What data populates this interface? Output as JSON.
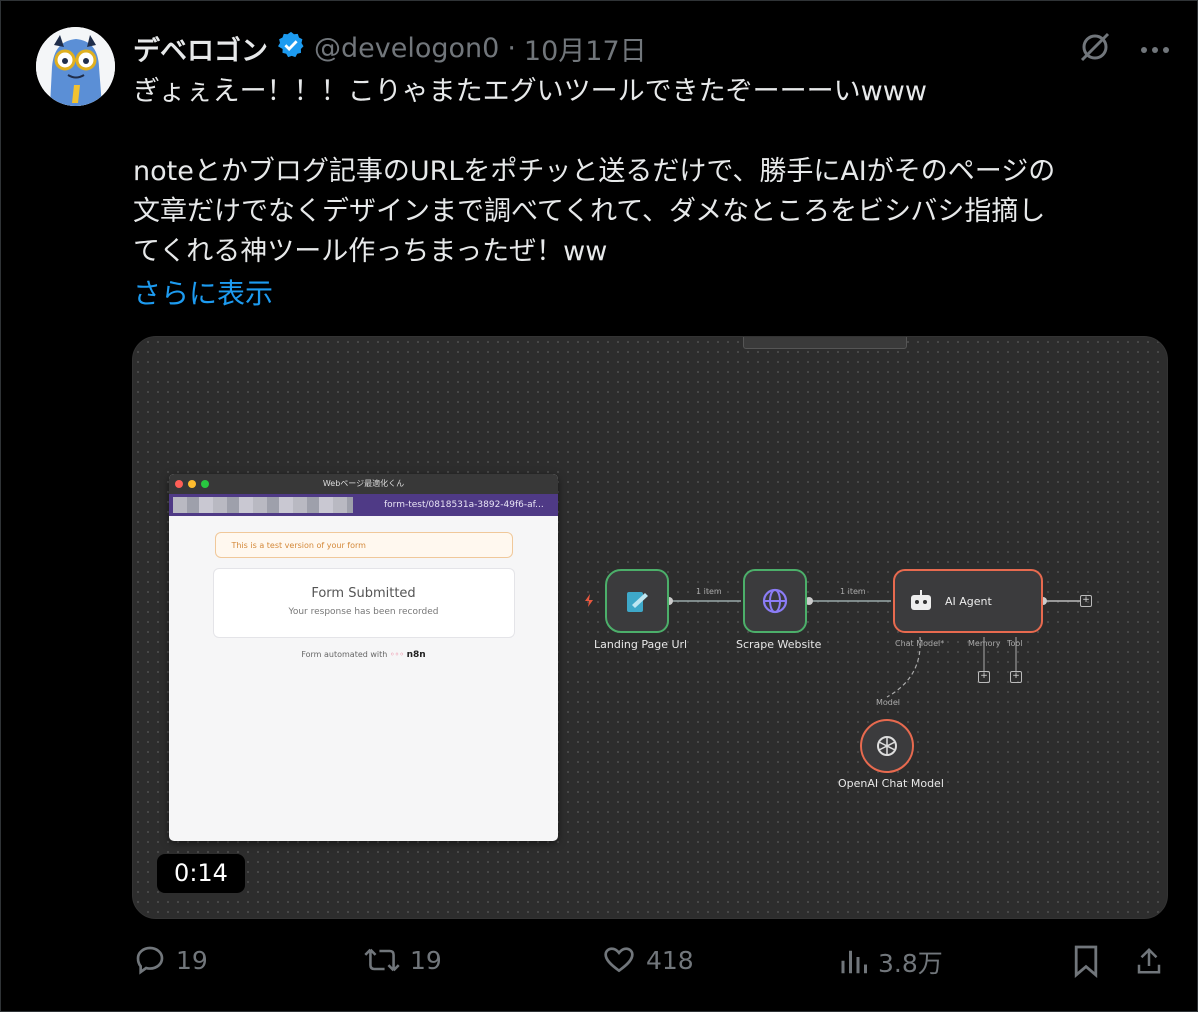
{
  "tweet": {
    "author_name": "デベロゴン",
    "handle": "@develogon0",
    "separator": "·",
    "date": "10月17日",
    "verified_color": "#1d9bf0",
    "text_line1": "ぎょぇえー！！！こりゃまたエグいツールできたぞーーーいwww",
    "text_line2": "noteとかブログ記事のURLをポチッと送るだけで、勝手にAIがそのページの",
    "text_line3": "文章だけでなくデザインまで調べてくれて、ダメなところをビシバシ指摘し",
    "text_line4": "てくれる神ツール作っちまったぜ！ww",
    "show_more": "さらに表示"
  },
  "media": {
    "window_title": "Webページ最適化くん",
    "url_text": "form-test/0818531a-3892-49f6-af...",
    "test_notice": "This is a test version of your form",
    "card_title": "Form Submitted",
    "card_subtitle": "Your response has been recorded",
    "powered_by": "Form automated with",
    "powered_brand": "n8n",
    "nodes": {
      "landing": "Landing Page Url",
      "scrape": "Scrape Website",
      "agent": "AI Agent",
      "openai": "OpenAI Chat Model"
    },
    "edge_label_1": "1 item",
    "edge_label_2": "1 item",
    "agent_port_chat": "Chat Model*",
    "agent_port_memory": "Memory",
    "agent_port_tool": "Tool",
    "model_label": "Model",
    "video_time": "0:14"
  },
  "actions": {
    "replies": "19",
    "retweets": "19",
    "likes": "418",
    "views": "3.8万"
  },
  "colors": {
    "link": "#1d9bf0",
    "muted": "#71767b",
    "node_success": "#4caf6a",
    "agent_border": "#e86a4f",
    "form_header": "#4f3a86"
  }
}
